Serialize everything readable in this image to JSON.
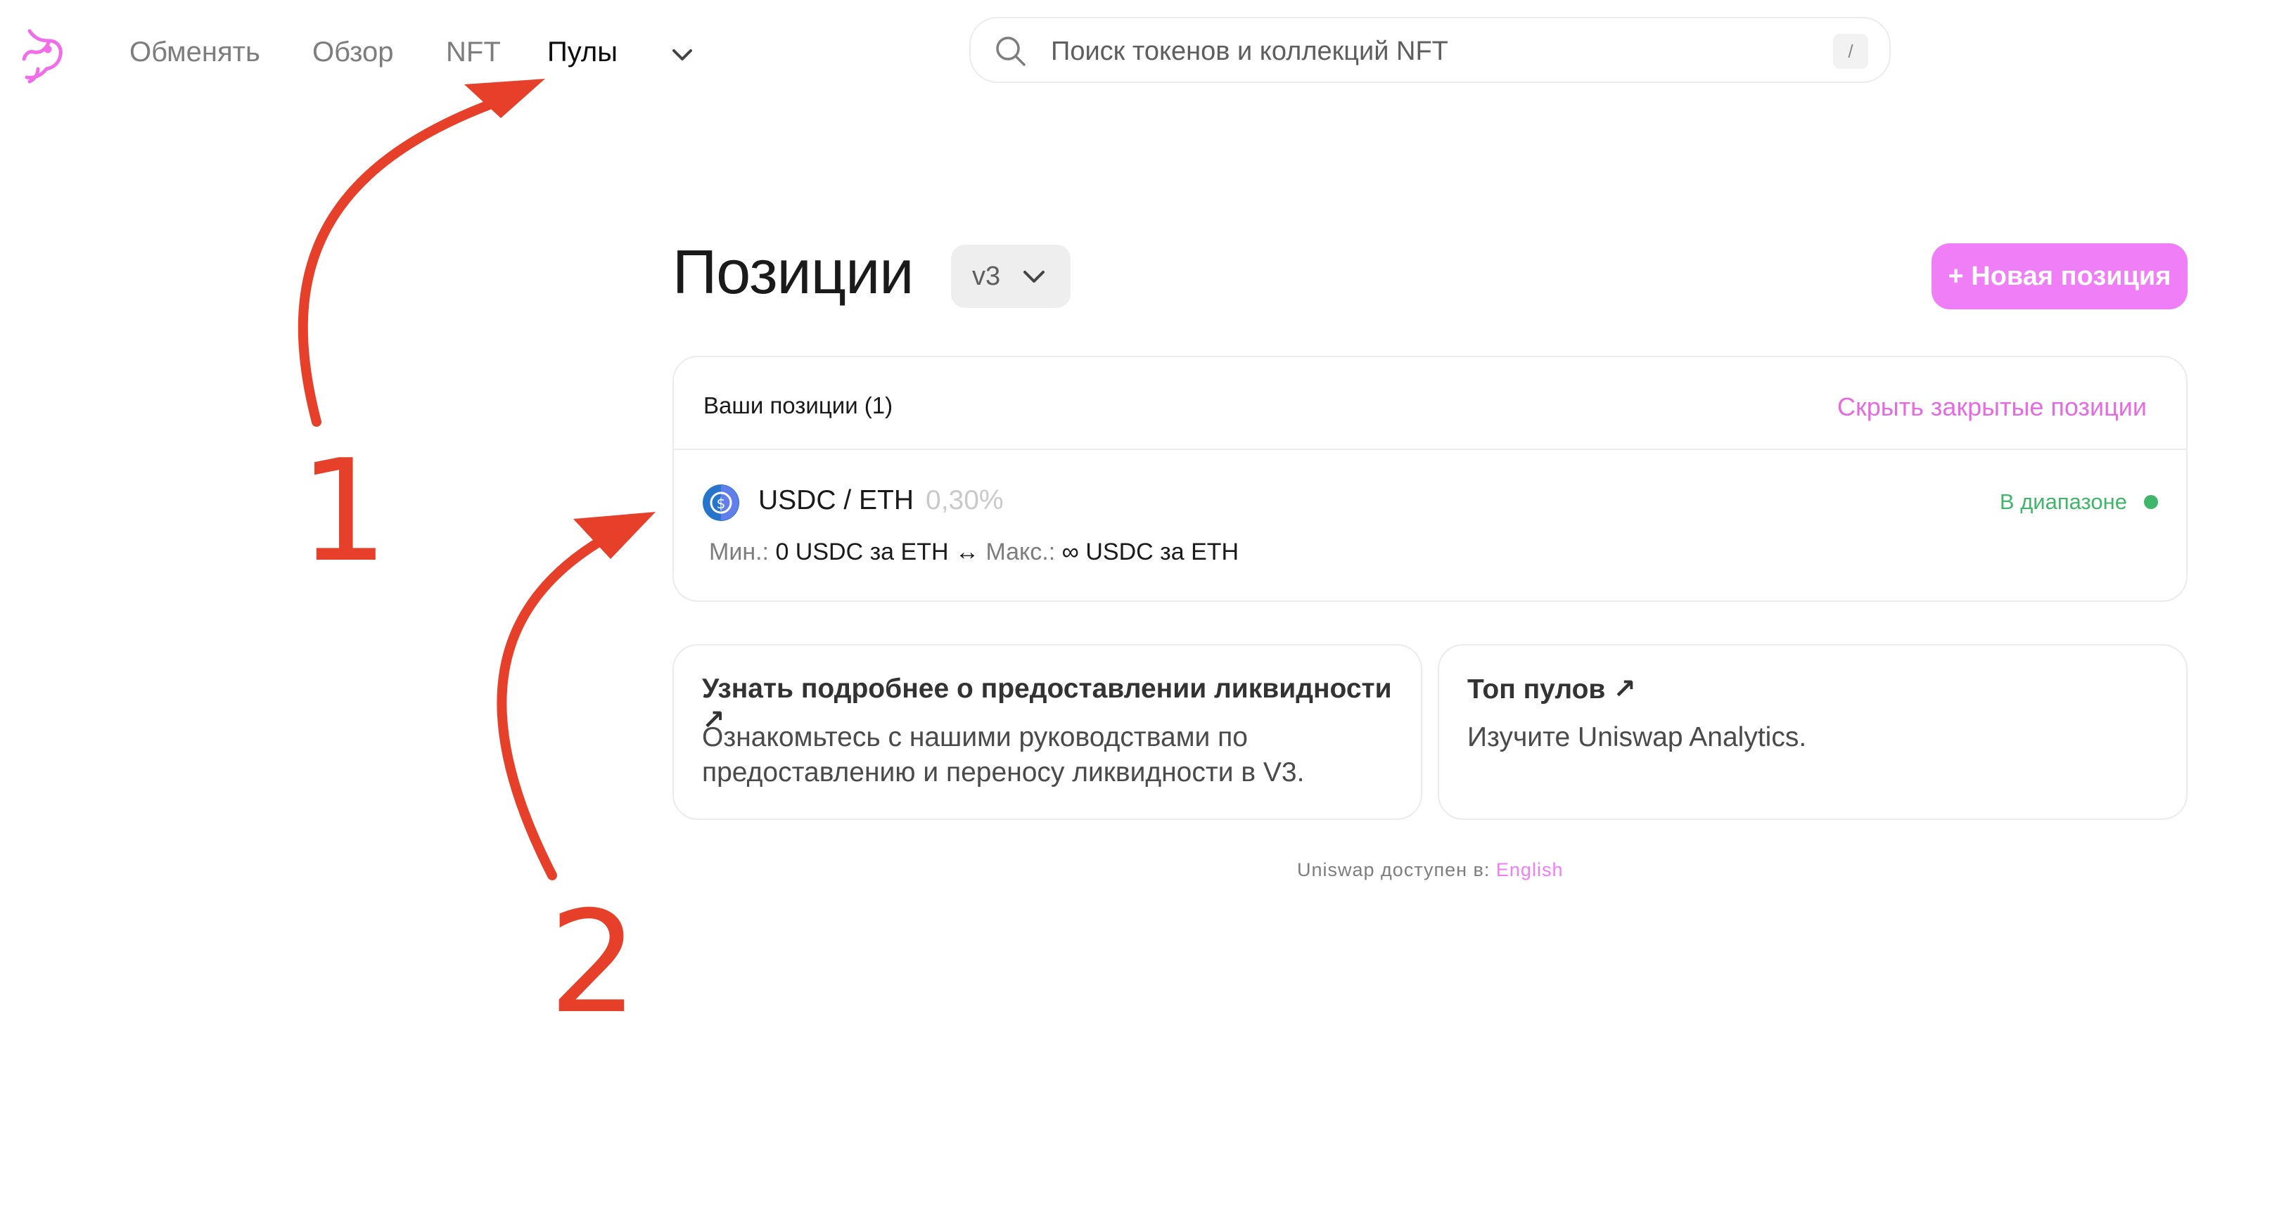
{
  "nav": {
    "items": [
      "Обменять",
      "Обзор",
      "NFT",
      "Пулы"
    ],
    "active": "Пулы"
  },
  "search": {
    "placeholder": "Поиск токенов и коллекций NFT",
    "shortcut": "/"
  },
  "page": {
    "title": "Позиции",
    "version": "v3",
    "new_position_label": "+ Новая позиция"
  },
  "positions": {
    "header": "Ваши позиции (1)",
    "hide_closed": "Скрыть закрытые позиции",
    "items": [
      {
        "pair": "USDC / ETH",
        "fee": "0,30%",
        "status": "В диапазоне",
        "min_label": "Мин.:",
        "min_value": "0 USDC за ETH",
        "arrow": "↔",
        "max_label": "Макс.:",
        "max_value": "∞ USDC за ETH"
      }
    ]
  },
  "info_cards": [
    {
      "title": "Узнать подробнее о предоставлении ликвидности ↗",
      "text": "Ознакомьтесь с нашими руководствами по предоставлению и переносу ликвидности в V3."
    },
    {
      "title": "Топ пулов ↗",
      "text": "Изучите Uniswap Analytics."
    }
  ],
  "footer": {
    "text": "Uniswap доступен в:",
    "link": "English"
  },
  "annotations": {
    "numbers": [
      "1",
      "2"
    ],
    "color": "#e7402a"
  },
  "colors": {
    "accent_pink": "#ef7ef7",
    "status_green": "#40b66b",
    "border": "#ececec"
  }
}
